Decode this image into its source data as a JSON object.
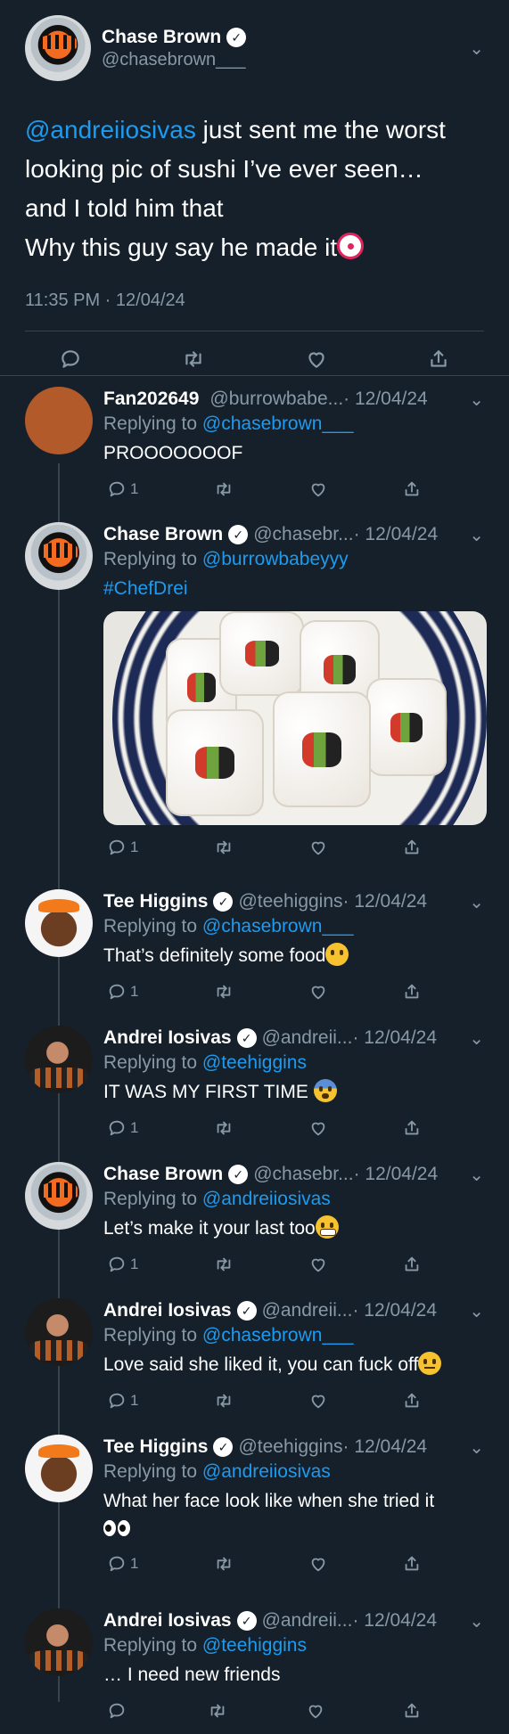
{
  "main_tweet": {
    "name": "Chase Brown",
    "handle": "@chasebrown___",
    "mention": "@andreiiosivas",
    "text_line1": " just sent me the worst looking pic of sushi I’ve ever seen…",
    "text_line2": "and I told him that",
    "text_line3": "Why this guy say he made it",
    "timestamp": "11:35 PM · 12/04/24"
  },
  "replies": [
    {
      "name": "Fan202649",
      "handle": "@burrowbabe...",
      "date": "· 12/04/24",
      "reply_label": "Replying to ",
      "reply_to": "@chasebrown___",
      "text": "PROOOOOOOF",
      "reply_count": "1"
    },
    {
      "name": "Chase Brown",
      "handle": "@chasebr...",
      "date": "· 12/04/24",
      "reply_label": "Replying to ",
      "reply_to": "@burrowbabeyyy",
      "text": "#ChefDrei",
      "reply_count": "1"
    },
    {
      "name": "Tee Higgins",
      "handle": "@teehiggins",
      "date": "· 12/04/24",
      "reply_label": "Replying to ",
      "reply_to": "@chasebrown___",
      "text": "That’s definitely some food",
      "reply_count": "1"
    },
    {
      "name": "Andrei Iosivas",
      "handle": "@andreii...",
      "date": "· 12/04/24",
      "reply_label": "Replying to ",
      "reply_to": "@teehiggins",
      "text": "IT WAS MY FIRST TIME ",
      "reply_count": "1"
    },
    {
      "name": "Chase Brown",
      "handle": "@chasebr...",
      "date": "· 12/04/24",
      "reply_label": "Replying to ",
      "reply_to": "@andreiiosivas",
      "text": "Let’s make it your last too",
      "reply_count": "1"
    },
    {
      "name": "Andrei Iosivas",
      "handle": "@andreii...",
      "date": "· 12/04/24",
      "reply_label": "Replying to ",
      "reply_to": "@chasebrown___",
      "text": "Love said she liked it, you can fuck off",
      "reply_count": "1"
    },
    {
      "name": "Tee Higgins",
      "handle": "@teehiggins",
      "date": "· 12/04/24",
      "reply_label": "Replying to ",
      "reply_to": "@andreiiosivas",
      "text": "What her face look like when she tried it",
      "reply_count": "1"
    },
    {
      "name": "Andrei Iosivas",
      "handle": "@andreii...",
      "date": "· 12/04/24",
      "reply_label": "Replying to ",
      "reply_to": "@teehiggins",
      "text": "… I need new friends",
      "reply_count": ""
    }
  ],
  "colors": {
    "background": "#15202b",
    "link": "#1d9bf0",
    "muted": "#8899a6",
    "divider": "#38444d"
  }
}
